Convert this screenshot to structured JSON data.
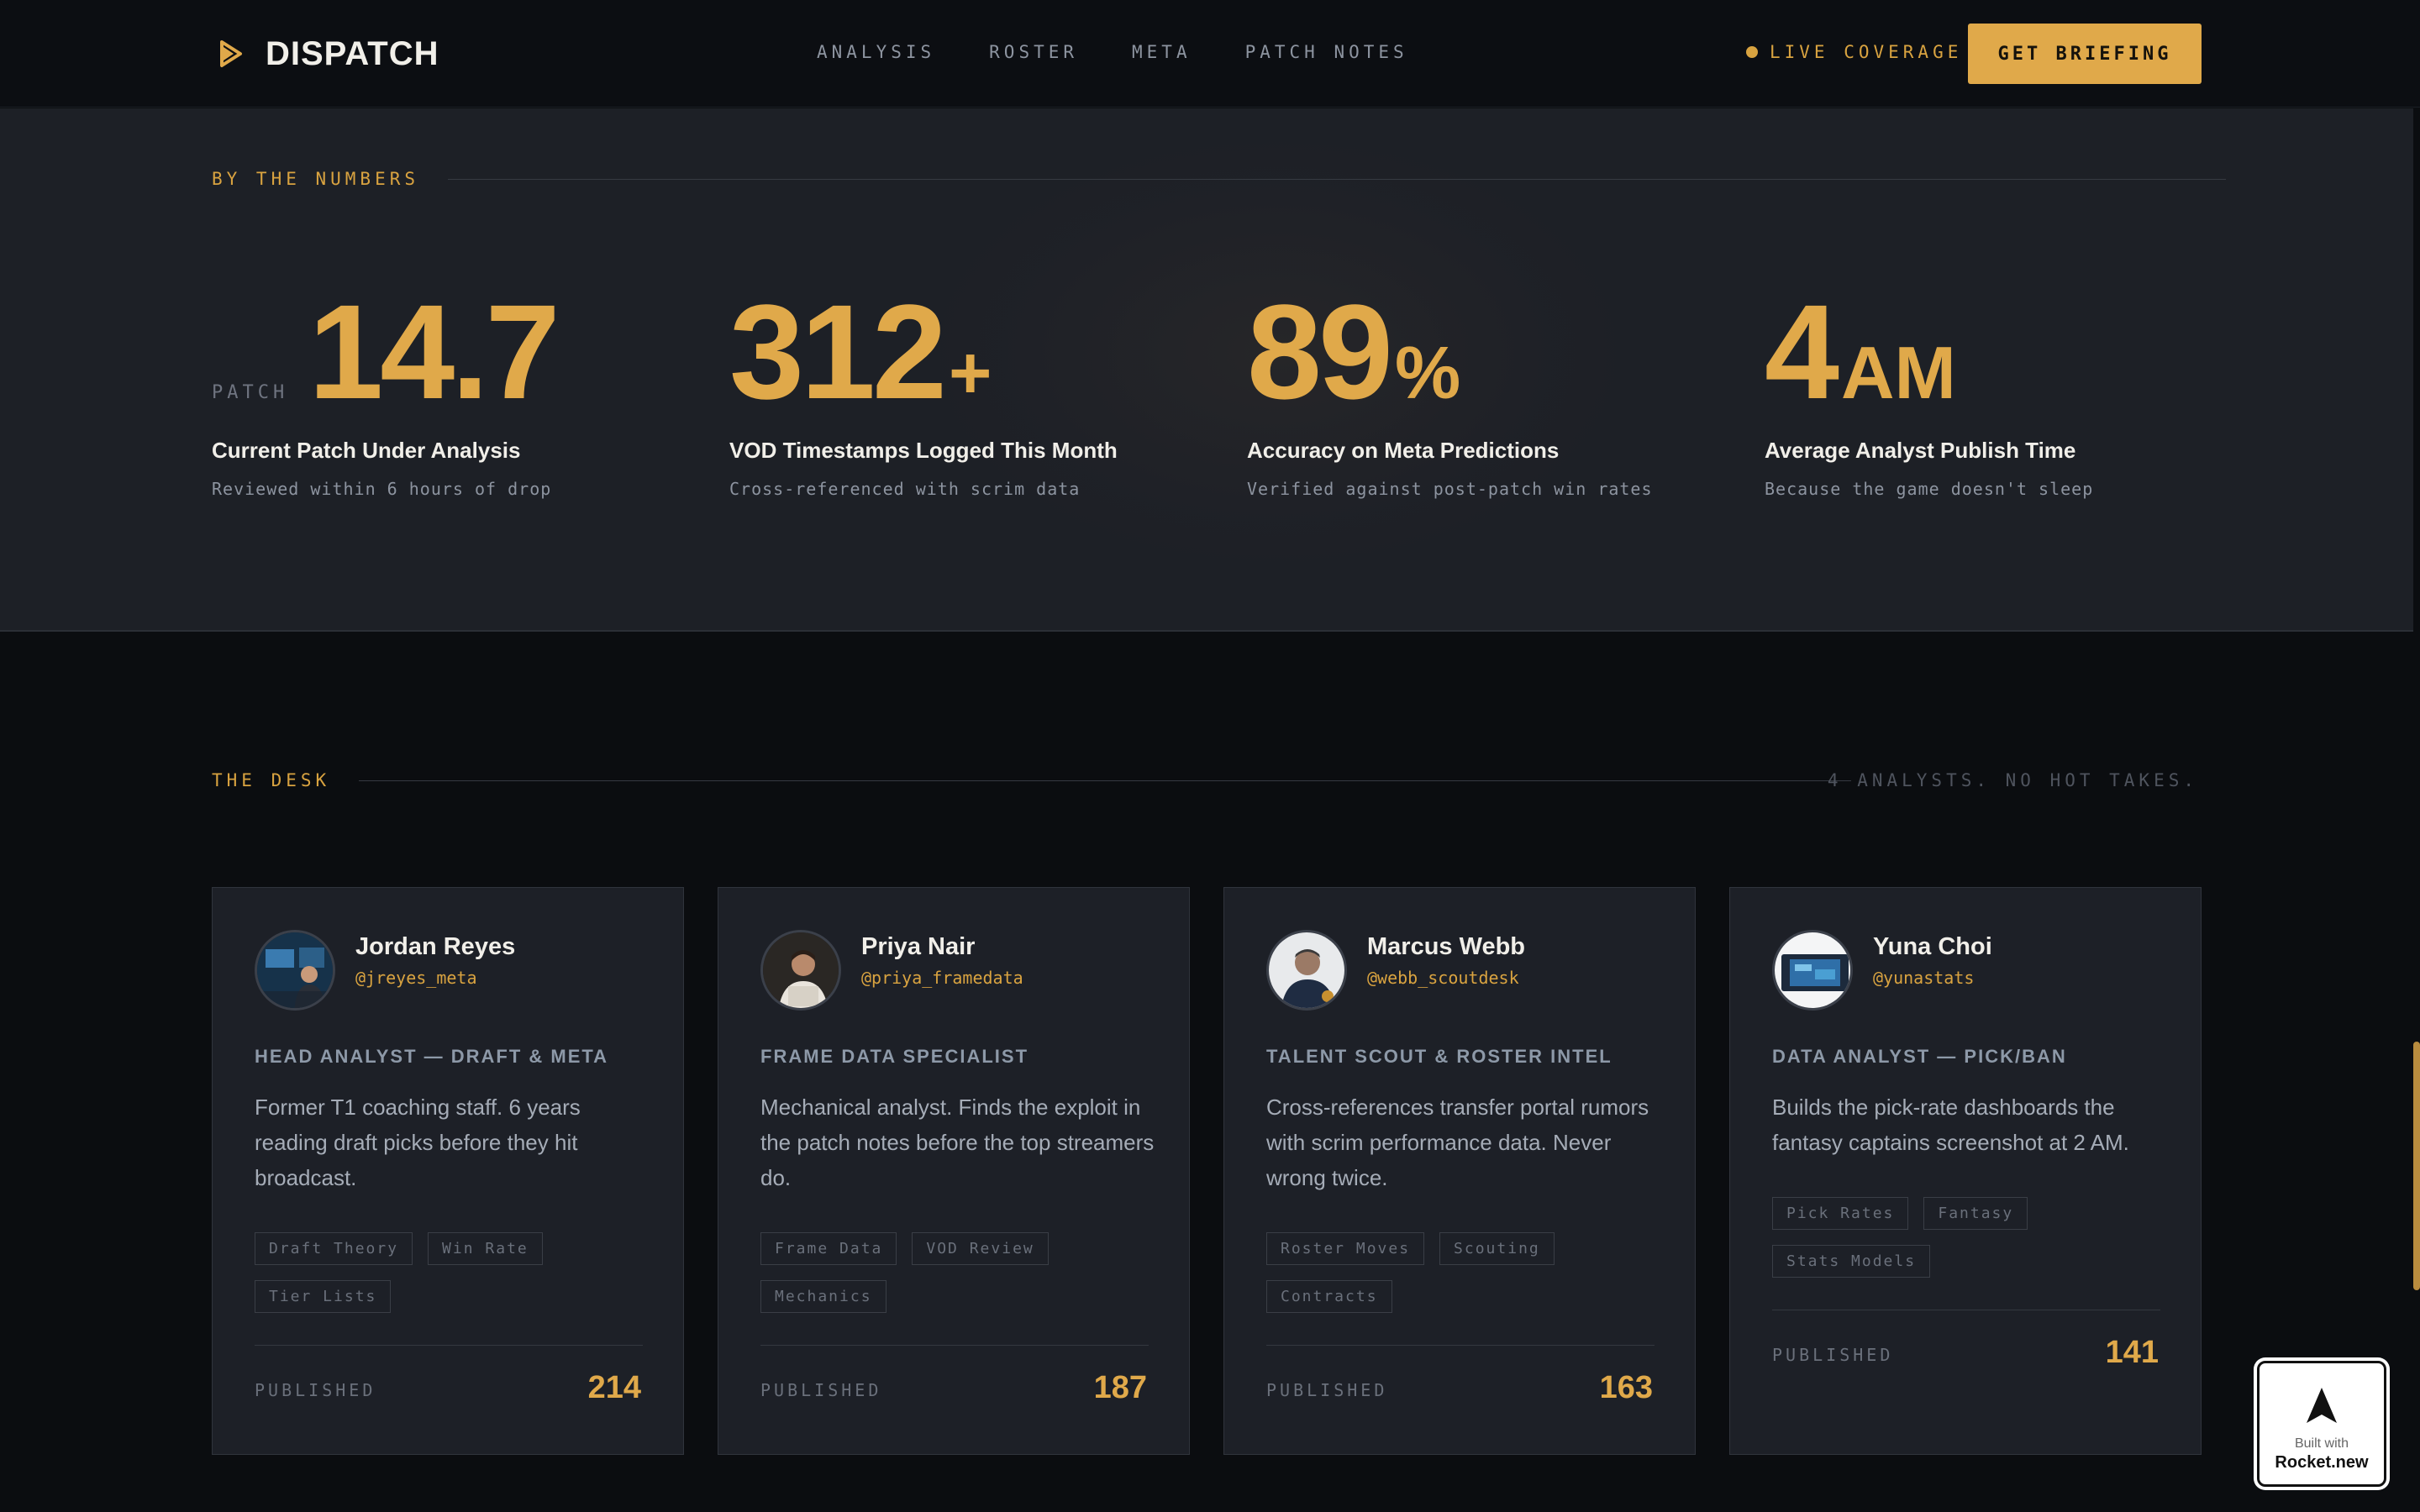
{
  "nav": {
    "brand": "DISPATCH",
    "links": [
      "ANALYSIS",
      "ROSTER",
      "META",
      "PATCH NOTES"
    ],
    "live": "LIVE COVERAGE",
    "cta": "GET BRIEFING"
  },
  "numbers": {
    "label": "BY THE NUMBERS",
    "stats": [
      {
        "prefix": "PATCH",
        "value": "14.7",
        "suffix": "",
        "title": "Current Patch Under Analysis",
        "sub": "Reviewed within 6 hours of drop"
      },
      {
        "prefix": "",
        "value": "312",
        "suffix": "+",
        "title": "VOD Timestamps Logged This Month",
        "sub": "Cross-referenced with scrim data"
      },
      {
        "prefix": "",
        "value": "89",
        "suffix": "%",
        "title": "Accuracy on Meta Predictions",
        "sub": "Verified against post-patch win rates"
      },
      {
        "prefix": "",
        "value": "4",
        "suffix": "AM",
        "title": "Average Analyst Publish Time",
        "sub": "Because the game doesn't sleep"
      }
    ]
  },
  "desk": {
    "label": "THE DESK",
    "tagline": "4 ANALYSTS. NO HOT TAKES.",
    "analysts": [
      {
        "name": "Jordan Reyes",
        "handle": "@jreyes_meta",
        "role": "HEAD ANALYST — DRAFT & META",
        "bio": "Former T1 coaching staff. 6 years reading draft picks before they hit broadcast.",
        "tags": [
          "Draft Theory",
          "Win Rate",
          "Tier Lists"
        ],
        "published_label": "PUBLISHED",
        "published": "214"
      },
      {
        "name": "Priya Nair",
        "handle": "@priya_framedata",
        "role": "FRAME DATA SPECIALIST",
        "bio": "Mechanical analyst. Finds the exploit in the patch notes before the top streamers do.",
        "tags": [
          "Frame Data",
          "VOD Review",
          "Mechanics"
        ],
        "published_label": "PUBLISHED",
        "published": "187"
      },
      {
        "name": "Marcus Webb",
        "handle": "@webb_scoutdesk",
        "role": "TALENT SCOUT & ROSTER INTEL",
        "bio": "Cross-references transfer portal rumors with scrim performance data. Never wrong twice.",
        "tags": [
          "Roster Moves",
          "Scouting",
          "Contracts"
        ],
        "published_label": "PUBLISHED",
        "published": "163"
      },
      {
        "name": "Yuna Choi",
        "handle": "@yunastats",
        "role": "DATA ANALYST — PICK/BAN",
        "bio": "Builds the pick-rate dashboards the fantasy captains screenshot at 2 AM.",
        "tags": [
          "Pick Rates",
          "Fantasy",
          "Stats Models"
        ],
        "published_label": "PUBLISHED",
        "published": "141"
      }
    ]
  },
  "badge": {
    "line1": "Built with",
    "line2": "Rocket.new"
  },
  "colors": {
    "accent": "#e0a94a",
    "background": "#0b0d10",
    "panel": "#1d2027"
  }
}
